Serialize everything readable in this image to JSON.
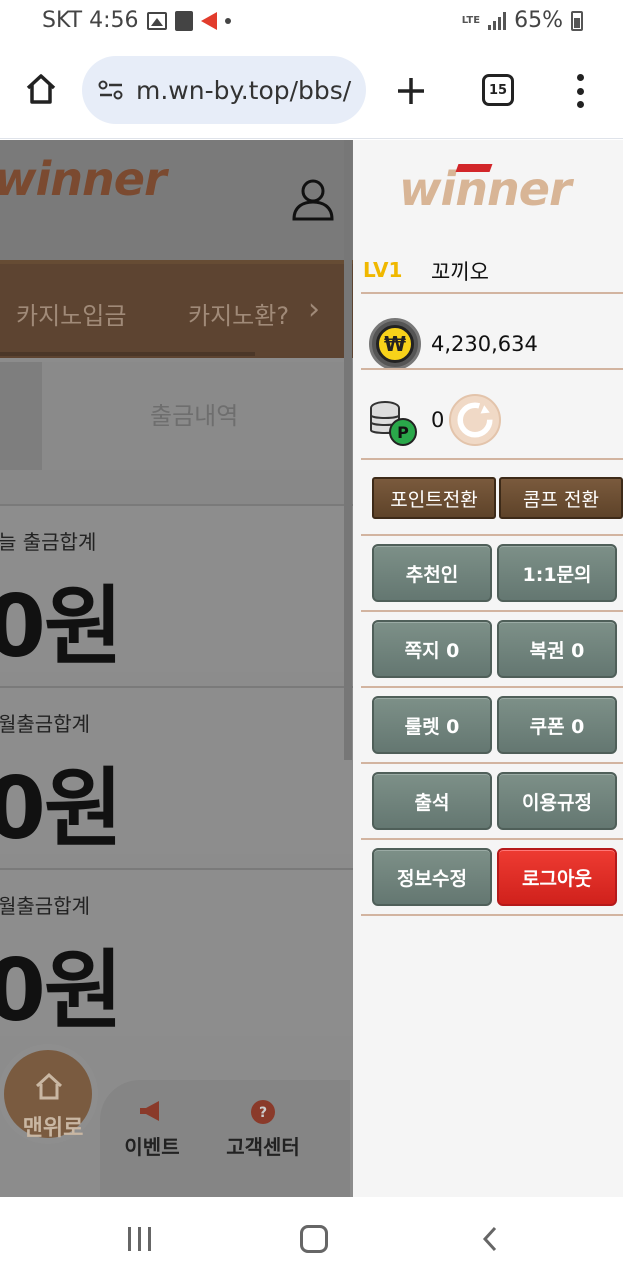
{
  "status_bar": {
    "carrier_time": "SKT 4:56",
    "network": "LTE",
    "battery": "65%"
  },
  "browser": {
    "url": "m.wn-by.top/bbs/",
    "tab_count": "15"
  },
  "page": {
    "logo": "winner",
    "nav": [
      "카지노입금",
      "카지노환?"
    ],
    "tab_label": "출금내역",
    "cards": [
      {
        "label": "늘 출금합계",
        "amount": "0원"
      },
      {
        "label": "월출금합계",
        "amount": "0원"
      },
      {
        "label": "월출금합계",
        "amount": "0원"
      }
    ],
    "bottom": {
      "top_button": "맨위로",
      "event": "이벤트",
      "support": "고객센터"
    }
  },
  "drawer": {
    "logo": "winner",
    "level": "LV1",
    "username": "꼬끼오",
    "money_icon": "₩",
    "money": "4,230,634",
    "points": "0",
    "point_icon_letter": "P",
    "point_convert": "포인트전환",
    "comp_convert": "콤프 전환",
    "buttons": {
      "referrer": "추천인",
      "inquiry": "1:1문의",
      "memo": "쪽지 0",
      "lottery": "복권 0",
      "roulette": "룰렛 0",
      "coupon": "쿠폰 0",
      "attendance": "출석",
      "terms": "이용규정",
      "edit_info": "정보수정",
      "logout": "로그아웃"
    }
  },
  "colors": {
    "accent_brown": "#6b4c33",
    "button_gray": "#6f827b",
    "logout_red": "#e12c25",
    "level_yellow": "#f0b800"
  }
}
